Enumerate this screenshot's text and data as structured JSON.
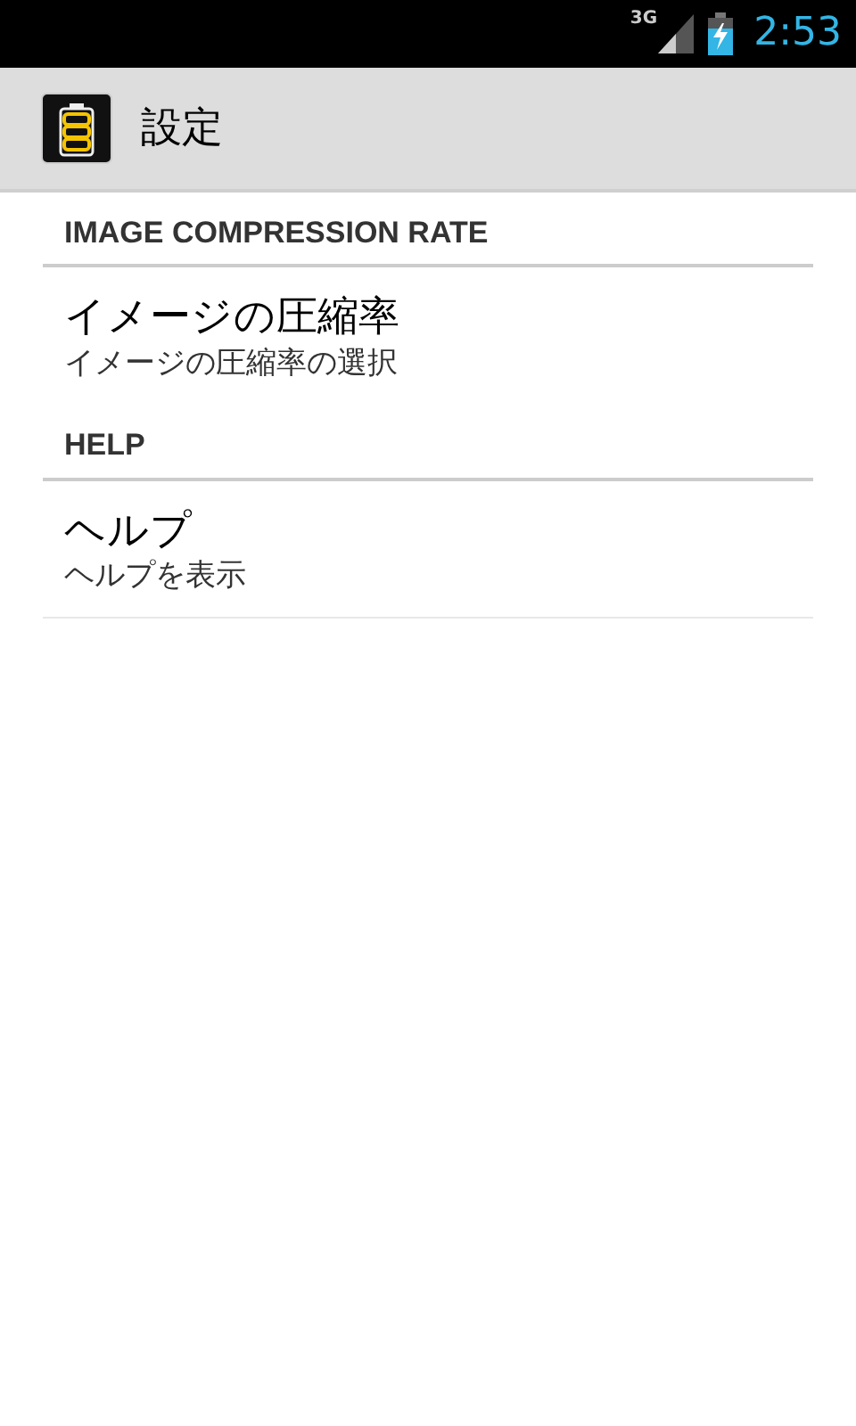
{
  "status_bar": {
    "network": "3G",
    "time": "2:53"
  },
  "action_bar": {
    "title": "設定"
  },
  "sections": [
    {
      "header": "IMAGE COMPRESSION RATE",
      "items": [
        {
          "title": "イメージの圧縮率",
          "summary": "イメージの圧縮率の選択"
        }
      ]
    },
    {
      "header": "HELP",
      "items": [
        {
          "title": "ヘルプ",
          "summary": "ヘルプを表示"
        }
      ]
    }
  ]
}
